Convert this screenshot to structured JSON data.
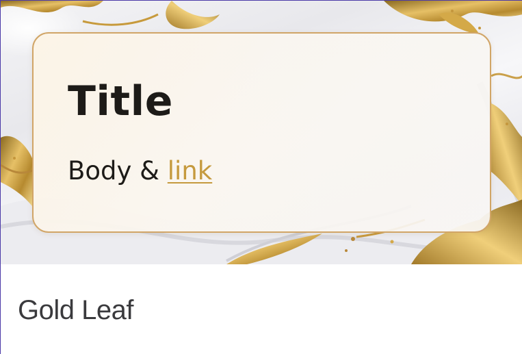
{
  "card": {
    "hero": {
      "image_description_icon": "marble-gold-background",
      "panel": {
        "title": "Title",
        "body_text": "Body & ",
        "link_text": "link"
      }
    },
    "footer": {
      "label": "Gold Leaf"
    }
  },
  "colors": {
    "accent_gold": "#c59a3e",
    "panel_border": "#d1a567",
    "text_dark": "#1d1b18",
    "footer_text": "#3a3a3d",
    "frame_border": "#4b3aa8"
  }
}
